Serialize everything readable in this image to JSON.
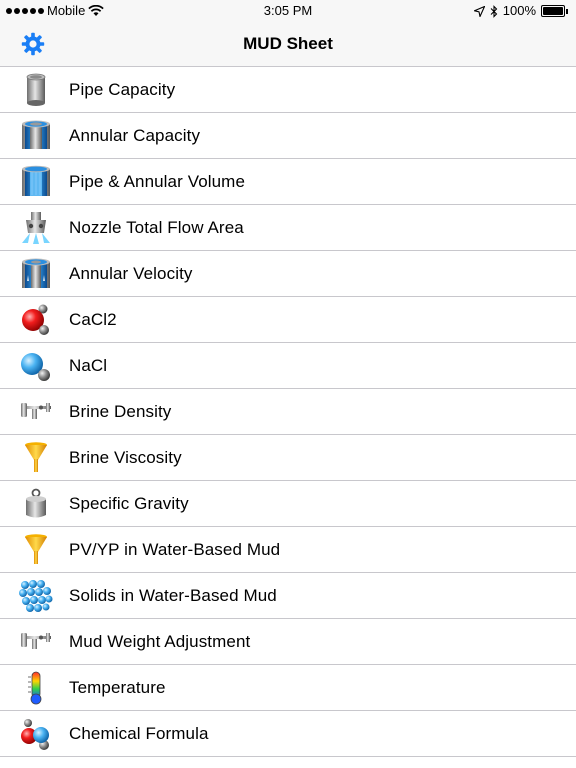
{
  "status": {
    "carrier": "Mobile",
    "time": "3:05 PM",
    "battery": "100%"
  },
  "nav": {
    "title": "MUD Sheet"
  },
  "items": [
    {
      "label": "Pipe Capacity",
      "icon": "pipe-icon"
    },
    {
      "label": "Annular Capacity",
      "icon": "annular-icon"
    },
    {
      "label": "Pipe & Annular Volume",
      "icon": "volume-icon"
    },
    {
      "label": "Nozzle Total Flow Area",
      "icon": "nozzle-icon"
    },
    {
      "label": "Annular Velocity",
      "icon": "velocity-icon"
    },
    {
      "label": "CaCl2",
      "icon": "molecule-red-icon"
    },
    {
      "label": "NaCl",
      "icon": "molecule-blue-icon"
    },
    {
      "label": "Brine Density",
      "icon": "hydrometer-icon"
    },
    {
      "label": "Brine Viscosity",
      "icon": "funnel-icon"
    },
    {
      "label": "Specific Gravity",
      "icon": "weight-icon"
    },
    {
      "label": "PV/YP in Water-Based Mud",
      "icon": "funnel-icon"
    },
    {
      "label": "Solids in Water-Based Mud",
      "icon": "solids-icon"
    },
    {
      "label": "Mud Weight Adjustment",
      "icon": "hydrometer-icon"
    },
    {
      "label": "Temperature",
      "icon": "thermometer-icon"
    },
    {
      "label": "Chemical Formula",
      "icon": "chemical-icon"
    }
  ]
}
